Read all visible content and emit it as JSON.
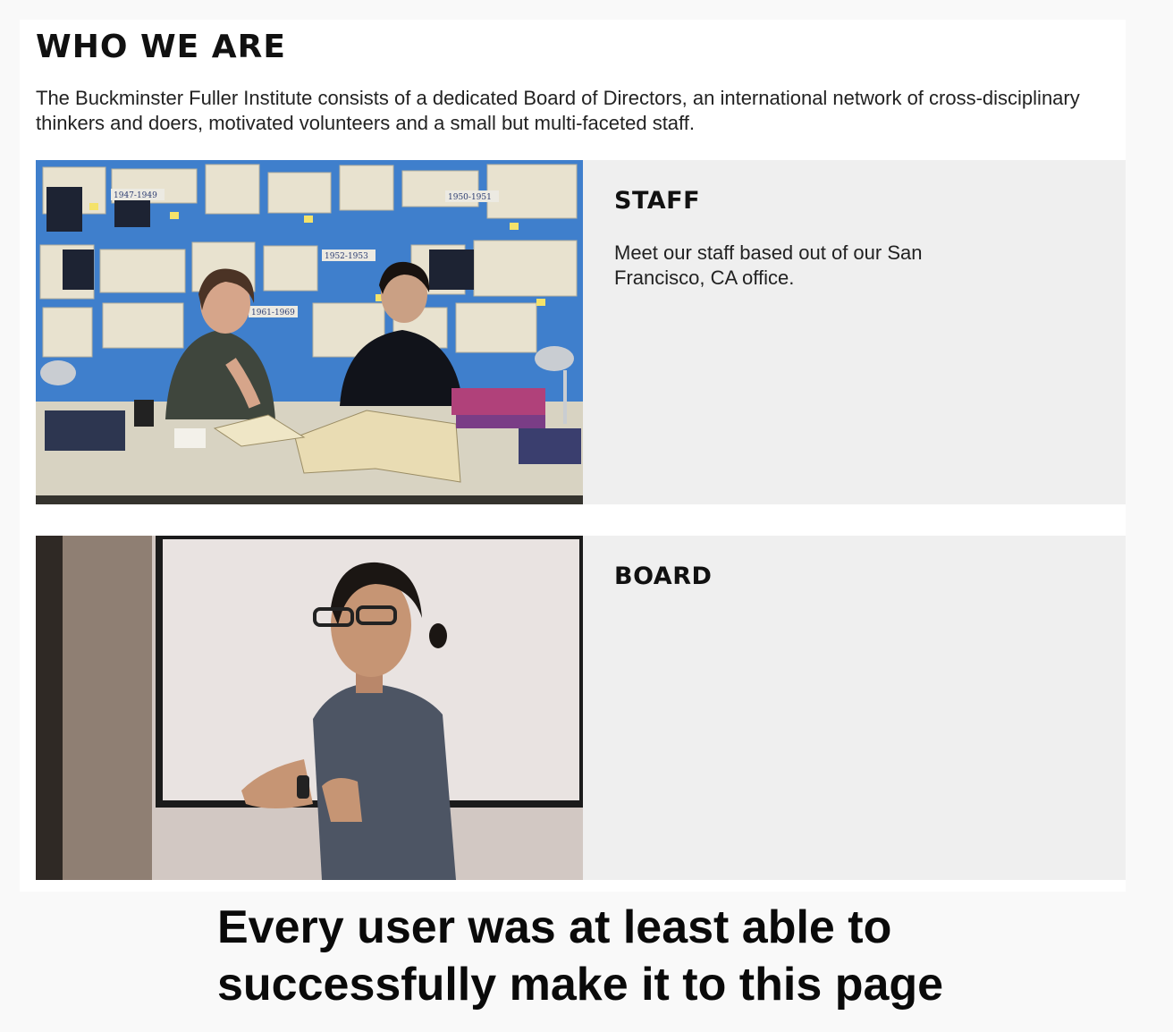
{
  "page": {
    "title": "WHO WE ARE",
    "intro": "The Buckminster Fuller Institute consists of a dedicated Board of Directors, an international network of cross-disciplinary thinkers and doers, motivated volunteers and a small but multi-faceted staff."
  },
  "staff": {
    "title": "STAFF",
    "text": "Meet our staff based out of our San Francisco, CA office.",
    "photo_labels": [
      "1947-1949",
      "1950-1951",
      "1952-1953",
      "1961-1969"
    ]
  },
  "board": {
    "title": "BOARD",
    "text": ""
  },
  "caption": "Every user was at least able to successfully make it to this page"
}
